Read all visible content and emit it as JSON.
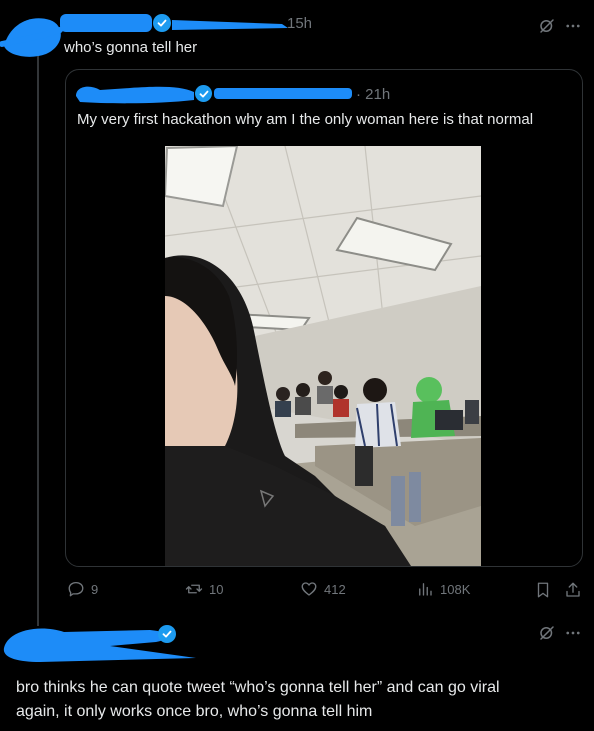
{
  "tweet1": {
    "time": "15h",
    "text": "who’s gonna tell her"
  },
  "quote": {
    "time": "· 21h",
    "text": "My very first hackathon why am I  the only woman here is that normal"
  },
  "actions": {
    "replies": "9",
    "retweets": "10",
    "likes": "412",
    "views": "108K"
  },
  "reply": {
    "text_line1": "bro thinks he can quote tweet “who’s gonna tell her” and can go viral",
    "text_line2": "again, it only works once bro, who’s gonna tell him"
  },
  "icons": [
    "grok-icon",
    "more-icon",
    "verified-icon",
    "reply-icon",
    "retweet-icon",
    "like-icon",
    "views-icon",
    "bookmark-icon",
    "share-icon"
  ],
  "colors": {
    "accent": "#1d9bf0",
    "scribble": "#1d8cf8",
    "muted": "#71767b",
    "text": "#e7e9ea"
  }
}
